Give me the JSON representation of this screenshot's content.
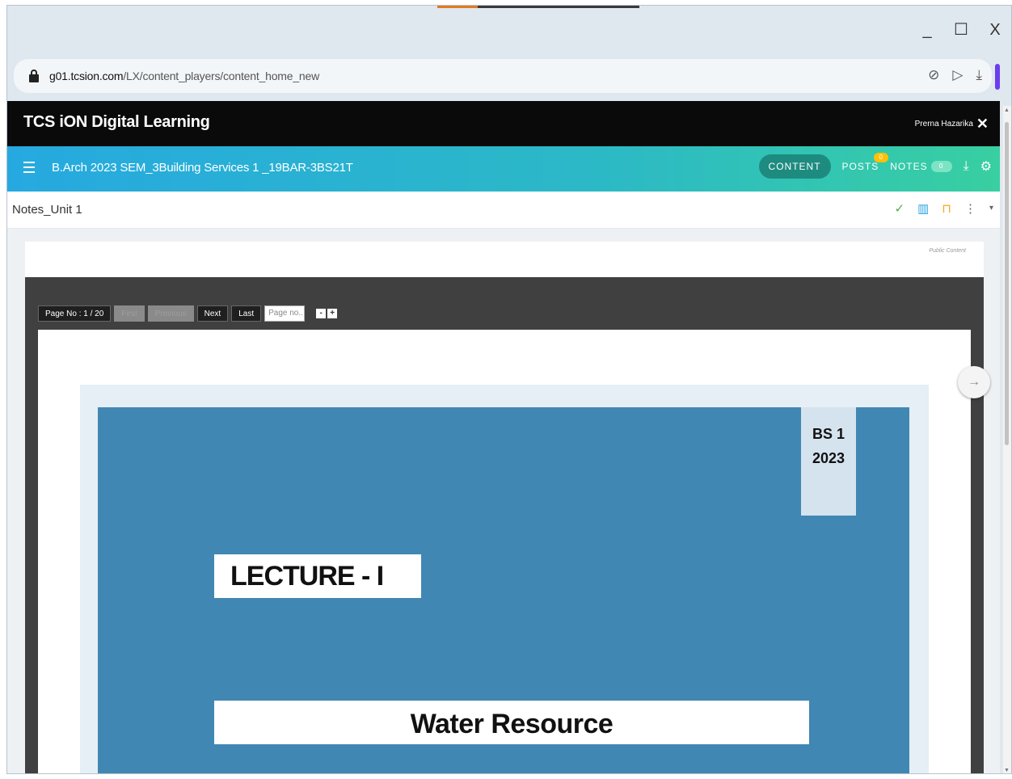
{
  "browser": {
    "window_controls": {
      "minimize": "_",
      "maximize": "☐",
      "close": "X"
    },
    "url_domain": "g01.tcsion.com",
    "url_path": "/LX/content_players/content_home_new",
    "address_icons": [
      "shield-check-icon",
      "send-icon",
      "download-icon"
    ]
  },
  "app": {
    "brand": "TCS iON Digital Learning",
    "user_name": "Prerna Hazarika",
    "close_glyph": "✕"
  },
  "course": {
    "title": "B.Arch 2023 SEM_3Building Services 1 _19BAR-3BS21T",
    "nav": {
      "content": "CONTENT",
      "posts": "POSTS",
      "posts_badge": "0",
      "notes": "NOTES",
      "notes_count": "0"
    }
  },
  "content_header": {
    "title": "Notes_Unit 1"
  },
  "viewer": {
    "public_label": "Public Content",
    "pager": {
      "page_label": "Page No : 1 / 20",
      "first": "First",
      "previous": "Previous",
      "next": "Next",
      "last": "Last",
      "page_input_placeholder": "Page no..",
      "zoom_out": "-",
      "zoom_in": "+"
    }
  },
  "slide": {
    "tag_line1": "BS 1",
    "tag_line2": "2023",
    "lecture": "LECTURE - I",
    "subject": "Water Resource"
  },
  "colors": {
    "topbar": "#0a0a0a",
    "course_gradient_start": "#26a9e0",
    "course_gradient_end": "#38cfa1",
    "slide_background": "#4187b3",
    "posts_badge": "#ffc107"
  }
}
